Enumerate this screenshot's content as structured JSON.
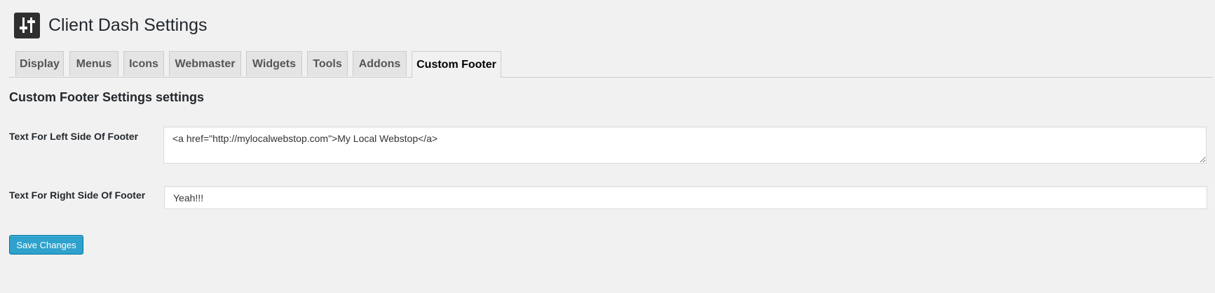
{
  "header": {
    "title": "Client Dash Settings",
    "icon": "sliders-icon"
  },
  "tabs": [
    {
      "label": "Display",
      "active": false
    },
    {
      "label": "Menus",
      "active": false
    },
    {
      "label": "Icons",
      "active": false
    },
    {
      "label": "Webmaster",
      "active": false
    },
    {
      "label": "Widgets",
      "active": false
    },
    {
      "label": "Tools",
      "active": false
    },
    {
      "label": "Addons",
      "active": false
    },
    {
      "label": "Custom Footer",
      "active": true
    }
  ],
  "section": {
    "title": "Custom Footer Settings settings"
  },
  "fields": {
    "left_footer": {
      "label": "Text For Left Side Of Footer",
      "value": "<a href=\"http://mylocalwebstop.com\">My Local Webstop</a>"
    },
    "right_footer": {
      "label": "Text For Right Side Of Footer",
      "value": "Yeah!!!"
    }
  },
  "actions": {
    "save_label": "Save Changes"
  },
  "colors": {
    "background": "#f1f1f1",
    "primary_button": "#2ea2cc",
    "primary_button_border": "#0074a2",
    "icon_background": "#2f2f2f"
  }
}
